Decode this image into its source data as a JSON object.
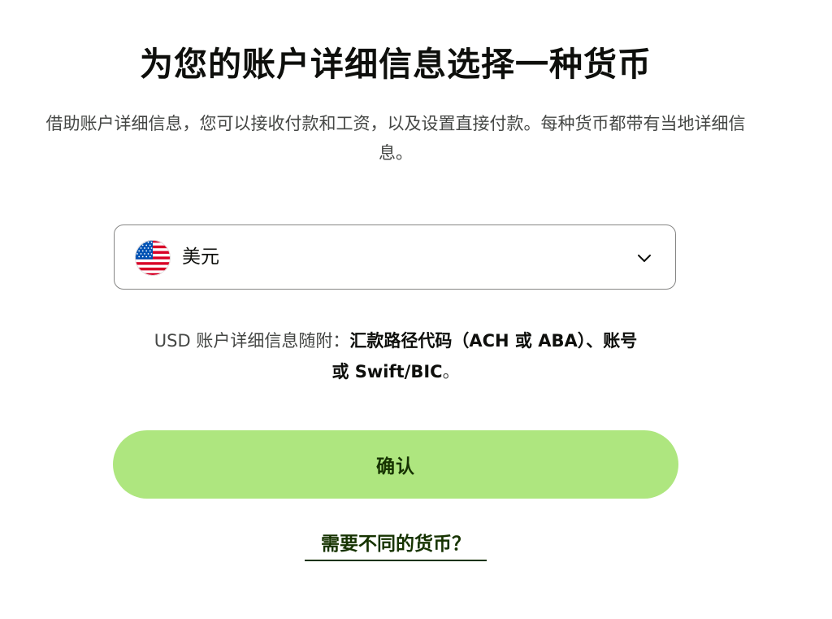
{
  "header": {
    "title": "为您的账户详细信息选择一种货币",
    "subtitle": "借助账户详细信息，您可以接收付款和工资，以及设置直接付款。每种货币都带有当地详细信息。"
  },
  "currency_select": {
    "selected_label": "美元",
    "flag_icon": "us-flag-icon",
    "chevron_icon": "chevron-down-icon"
  },
  "account_details": {
    "prefix": "USD 账户详细信息随附：",
    "bold_part_1": "汇款路径代码（ACH 或 ABA）、账号",
    "bold_part_2": "或 Swift/BIC",
    "suffix": "。"
  },
  "actions": {
    "confirm_label": "确认",
    "alt_link_label": "需要不同的货币？"
  },
  "colors": {
    "primary_button": "#aee67f",
    "primary_button_text": "#163300",
    "text_primary": "#0e0f0c",
    "text_secondary": "#454745",
    "border": "#868685"
  }
}
